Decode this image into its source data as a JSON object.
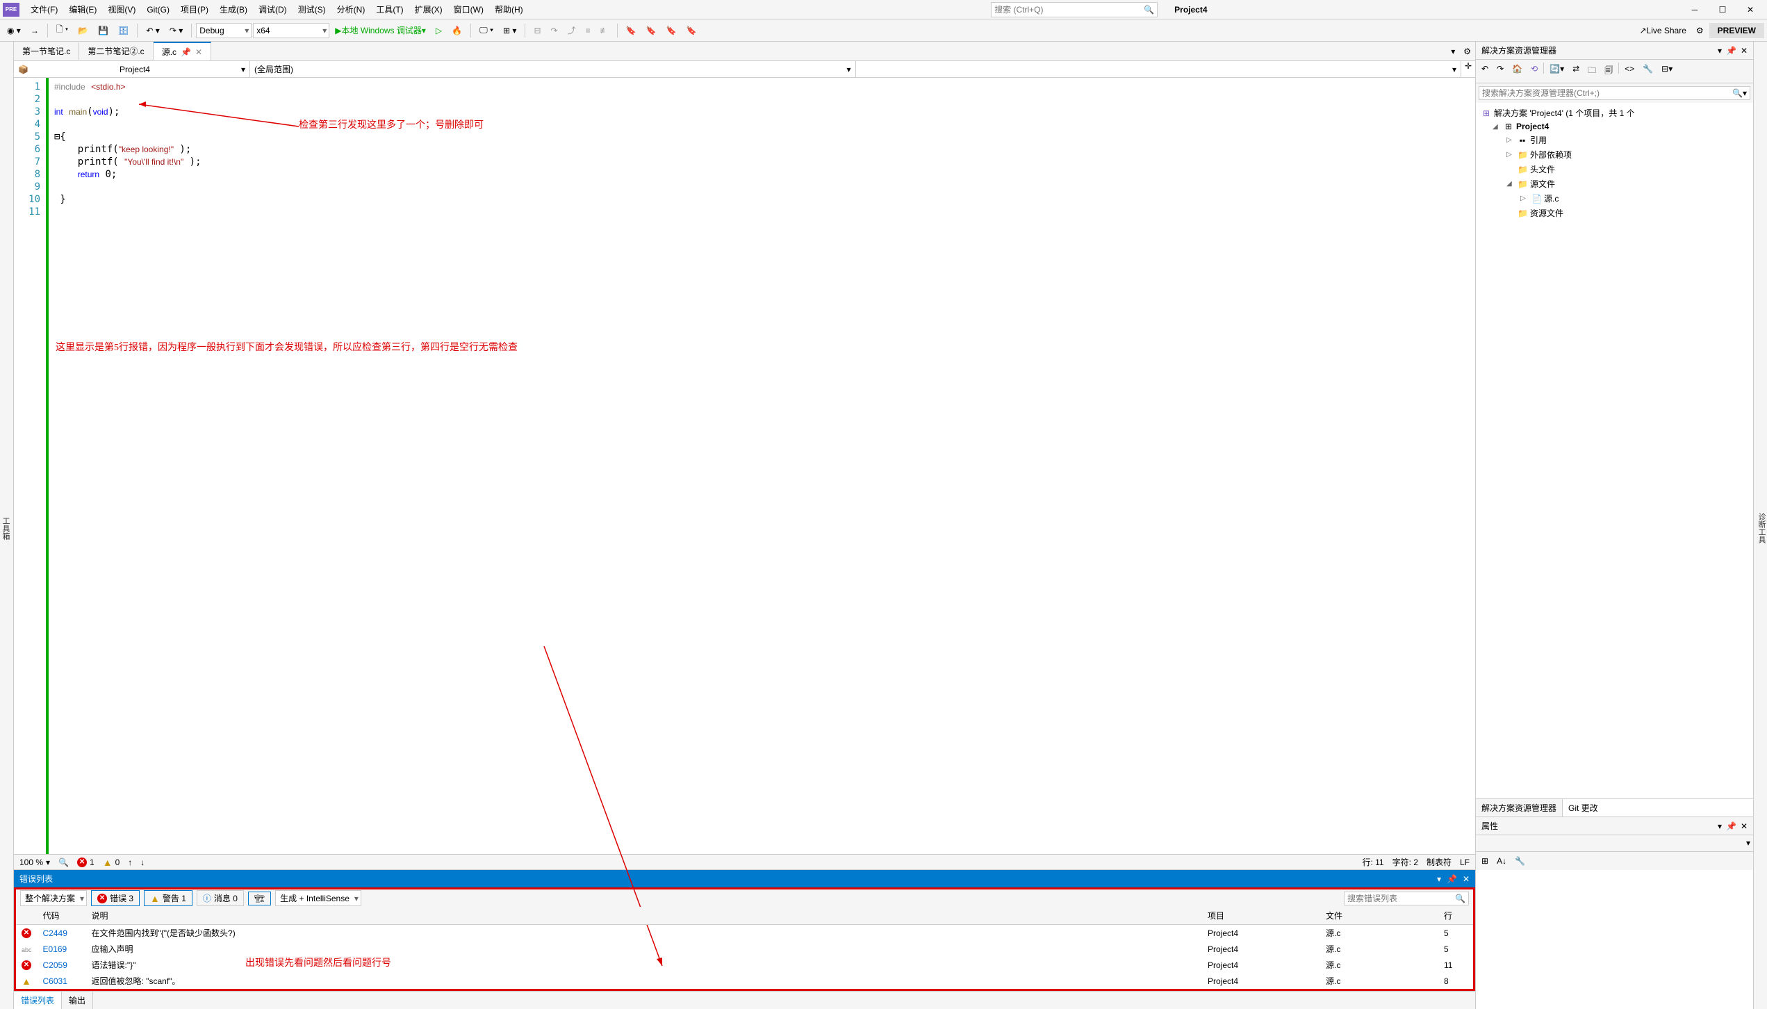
{
  "menu": {
    "file": "文件(F)",
    "edit": "编辑(E)",
    "view": "视图(V)",
    "git": "Git(G)",
    "project": "项目(P)",
    "build": "生成(B)",
    "debug": "调试(D)",
    "test": "测试(S)",
    "analyze": "分析(N)",
    "tools": "工具(T)",
    "extensions": "扩展(X)",
    "window": "窗口(W)",
    "help": "帮助(H)"
  },
  "search_placeholder": "搜索 (Ctrl+Q)",
  "project_name": "Project4",
  "toolbar": {
    "config": "Debug",
    "platform": "x64",
    "debugger": "本地 Windows 调试器",
    "live_share": "Live Share",
    "preview": "PREVIEW"
  },
  "tabs": [
    {
      "label": "第一节笔记.c"
    },
    {
      "label": "第二节笔记②.c"
    },
    {
      "label": "源.c",
      "active": true
    }
  ],
  "nav": {
    "left": "Project4",
    "mid": "(全局范围)",
    "right": ""
  },
  "code_lines": [
    "#include <stdio.h>",
    "",
    "int main(void);",
    "",
    "{",
    "    printf(\"keep looking!\" );",
    "    printf( \"You\\'ll find it!\\n\" );",
    "    return 0;",
    "",
    "}",
    ""
  ],
  "annotations": {
    "top": "检查第三行发现这里多了一个；号删除即可",
    "mid": "这里显示是第5行报错，因为程序一般执行到下面才会发现错误，所以应检查第三行，第四行是空行无需检查",
    "bottom": "出现错误先看问题然后看问题行号"
  },
  "status": {
    "zoom": "100 %",
    "errors": "1",
    "warnings": "0",
    "line": "行: 11",
    "col": "字符: 2",
    "tabs": "制表符",
    "end": "LF"
  },
  "error_panel": {
    "title": "错误列表",
    "scope": "整个解决方案",
    "err_btn": "错误 3",
    "warn_btn": "警告 1",
    "info_btn": "消息 0",
    "filter": "生成 + IntelliSense",
    "search_placeholder": "搜索错误列表",
    "cols": {
      "code": "代码",
      "desc": "说明",
      "proj": "项目",
      "file": "文件",
      "line": "行"
    },
    "rows": [
      {
        "icon": "err",
        "code": "C2449",
        "desc": "在文件范围内找到\"{\"(是否缺少函数头?)",
        "proj": "Project4",
        "file": "源.c",
        "line": "5"
      },
      {
        "icon": "abc",
        "code": "E0169",
        "desc": "应输入声明",
        "proj": "Project4",
        "file": "源.c",
        "line": "5"
      },
      {
        "icon": "err",
        "code": "C2059",
        "desc": "语法错误:\"}\"",
        "proj": "Project4",
        "file": "源.c",
        "line": "11"
      },
      {
        "icon": "warn",
        "code": "C6031",
        "desc": "返回值被忽略: \"scanf\"。",
        "proj": "Project4",
        "file": "源.c",
        "line": "8"
      }
    ]
  },
  "bottom_tabs": {
    "errors": "错误列表",
    "output": "输出"
  },
  "solution_explorer": {
    "title": "解决方案资源管理器",
    "search_placeholder": "搜索解决方案资源管理器(Ctrl+;)",
    "solution": "解决方案 'Project4' (1 个项目，共 1 个",
    "project": "Project4",
    "refs": "引用",
    "external": "外部依赖项",
    "headers": "头文件",
    "sources": "源文件",
    "source_file": "源.c",
    "resources": "资源文件"
  },
  "rp_tabs": {
    "sol": "解决方案资源管理器",
    "git": "Git 更改"
  },
  "props": {
    "title": "属性"
  },
  "left_sidebar": "工具箱",
  "right_sidebar": "诊断工具"
}
